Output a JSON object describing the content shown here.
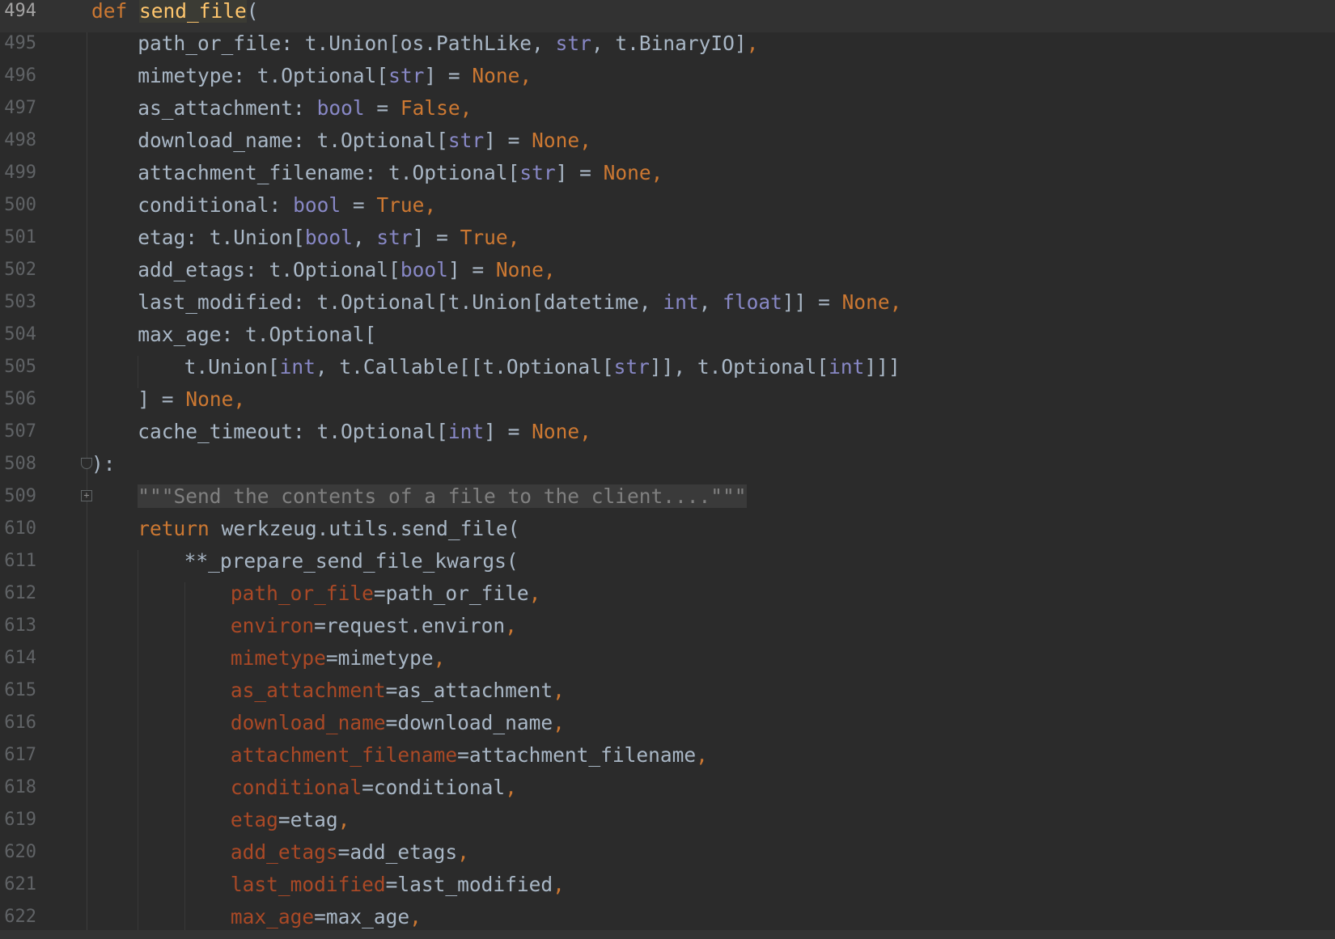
{
  "editor": {
    "current_line": "494",
    "lines": [
      {
        "num": "494",
        "indent": 0,
        "tokens": [
          [
            "def ",
            "keyword"
          ],
          [
            "|",
            "caret"
          ],
          [
            "send_file",
            "fn"
          ],
          [
            "(",
            "plain"
          ]
        ]
      },
      {
        "num": "495",
        "indent": 1,
        "tokens": [
          [
            "path_or_file: t.Union[os.PathLike, ",
            "plain"
          ],
          [
            "str",
            "builtin"
          ],
          [
            ", t.BinaryIO]",
            "plain"
          ],
          [
            ",",
            "punct"
          ]
        ]
      },
      {
        "num": "496",
        "indent": 1,
        "tokens": [
          [
            "mimetype: t.Optional[",
            "plain"
          ],
          [
            "str",
            "builtin"
          ],
          [
            "] = ",
            "plain"
          ],
          [
            "None",
            "const"
          ],
          [
            ",",
            "punct"
          ]
        ]
      },
      {
        "num": "497",
        "indent": 1,
        "tokens": [
          [
            "as_attachment: ",
            "plain"
          ],
          [
            "bool",
            "builtin"
          ],
          [
            " = ",
            "plain"
          ],
          [
            "False",
            "const"
          ],
          [
            ",",
            "punct"
          ]
        ]
      },
      {
        "num": "498",
        "indent": 1,
        "tokens": [
          [
            "download_name: t.Optional[",
            "plain"
          ],
          [
            "str",
            "builtin"
          ],
          [
            "] = ",
            "plain"
          ],
          [
            "None",
            "const"
          ],
          [
            ",",
            "punct"
          ]
        ]
      },
      {
        "num": "499",
        "indent": 1,
        "tokens": [
          [
            "attachment_filename: t.Optional[",
            "plain"
          ],
          [
            "str",
            "builtin"
          ],
          [
            "] = ",
            "plain"
          ],
          [
            "None",
            "const"
          ],
          [
            ",",
            "punct"
          ]
        ]
      },
      {
        "num": "500",
        "indent": 1,
        "tokens": [
          [
            "conditional: ",
            "plain"
          ],
          [
            "bool",
            "builtin"
          ],
          [
            " = ",
            "plain"
          ],
          [
            "True",
            "const"
          ],
          [
            ",",
            "punct"
          ]
        ]
      },
      {
        "num": "501",
        "indent": 1,
        "tokens": [
          [
            "etag: t.Union[",
            "plain"
          ],
          [
            "bool",
            "builtin"
          ],
          [
            ", ",
            "plain"
          ],
          [
            "str",
            "builtin"
          ],
          [
            "] = ",
            "plain"
          ],
          [
            "True",
            "const"
          ],
          [
            ",",
            "punct"
          ]
        ]
      },
      {
        "num": "502",
        "indent": 1,
        "tokens": [
          [
            "add_etags: t.Optional[",
            "plain"
          ],
          [
            "bool",
            "builtin"
          ],
          [
            "] = ",
            "plain"
          ],
          [
            "None",
            "const"
          ],
          [
            ",",
            "punct"
          ]
        ]
      },
      {
        "num": "503",
        "indent": 1,
        "tokens": [
          [
            "last_modified: t.Optional[t.Union[datetime, ",
            "plain"
          ],
          [
            "int",
            "builtin"
          ],
          [
            ", ",
            "plain"
          ],
          [
            "float",
            "builtin"
          ],
          [
            "]] = ",
            "plain"
          ],
          [
            "None",
            "const"
          ],
          [
            ",",
            "punct"
          ]
        ]
      },
      {
        "num": "504",
        "indent": 1,
        "tokens": [
          [
            "max_age: t.Optional[",
            "plain"
          ]
        ]
      },
      {
        "num": "505",
        "indent": 2,
        "tokens": [
          [
            "t.Union[",
            "plain"
          ],
          [
            "int",
            "builtin"
          ],
          [
            ", t.Callable[[t.Optional[",
            "plain"
          ],
          [
            "str",
            "builtin"
          ],
          [
            "]], t.Optional[",
            "plain"
          ],
          [
            "int",
            "builtin"
          ],
          [
            "]]]",
            "plain"
          ]
        ]
      },
      {
        "num": "506",
        "indent": 1,
        "tokens": [
          [
            "] = ",
            "plain"
          ],
          [
            "None",
            "const"
          ],
          [
            ",",
            "punct"
          ]
        ]
      },
      {
        "num": "507",
        "indent": 1,
        "tokens": [
          [
            "cache_timeout: t.Optional[",
            "plain"
          ],
          [
            "int",
            "builtin"
          ],
          [
            "] = ",
            "plain"
          ],
          [
            "None",
            "const"
          ],
          [
            ",",
            "punct"
          ]
        ]
      },
      {
        "num": "508",
        "indent": 0,
        "fold": "end",
        "tokens": [
          [
            "):",
            "plain"
          ]
        ]
      },
      {
        "num": "509",
        "indent": 1,
        "fold": "collapsed",
        "tokens": [
          [
            "\"\"\"Send the contents of a file to the client....\"\"\"",
            "doc"
          ]
        ]
      },
      {
        "num": "610",
        "indent": 1,
        "tokens": [
          [
            "return ",
            "keyword"
          ],
          [
            "werkzeug.utils.send_file(",
            "plain"
          ]
        ]
      },
      {
        "num": "611",
        "indent": 2,
        "tokens": [
          [
            "**_prepare_send_file_kwargs(",
            "plain"
          ]
        ]
      },
      {
        "num": "612",
        "indent": 3,
        "tokens": [
          [
            "path_or_file",
            "kwarg"
          ],
          [
            "=path_or_file",
            "plain"
          ],
          [
            ",",
            "punct"
          ]
        ]
      },
      {
        "num": "613",
        "indent": 3,
        "tokens": [
          [
            "environ",
            "kwarg"
          ],
          [
            "=request.environ",
            "plain"
          ],
          [
            ",",
            "punct"
          ]
        ]
      },
      {
        "num": "614",
        "indent": 3,
        "tokens": [
          [
            "mimetype",
            "kwarg"
          ],
          [
            "=mimetype",
            "plain"
          ],
          [
            ",",
            "punct"
          ]
        ]
      },
      {
        "num": "615",
        "indent": 3,
        "tokens": [
          [
            "as_attachment",
            "kwarg"
          ],
          [
            "=as_attachment",
            "plain"
          ],
          [
            ",",
            "punct"
          ]
        ]
      },
      {
        "num": "616",
        "indent": 3,
        "tokens": [
          [
            "download_name",
            "kwarg"
          ],
          [
            "=download_name",
            "plain"
          ],
          [
            ",",
            "punct"
          ]
        ]
      },
      {
        "num": "617",
        "indent": 3,
        "tokens": [
          [
            "attachment_filename",
            "kwarg"
          ],
          [
            "=attachment_filename",
            "plain"
          ],
          [
            ",",
            "punct"
          ]
        ]
      },
      {
        "num": "618",
        "indent": 3,
        "tokens": [
          [
            "conditional",
            "kwarg"
          ],
          [
            "=conditional",
            "plain"
          ],
          [
            ",",
            "punct"
          ]
        ]
      },
      {
        "num": "619",
        "indent": 3,
        "tokens": [
          [
            "etag",
            "kwarg"
          ],
          [
            "=etag",
            "plain"
          ],
          [
            ",",
            "punct"
          ]
        ]
      },
      {
        "num": "620",
        "indent": 3,
        "tokens": [
          [
            "add_etags",
            "kwarg"
          ],
          [
            "=add_etags",
            "plain"
          ],
          [
            ",",
            "punct"
          ]
        ]
      },
      {
        "num": "621",
        "indent": 3,
        "tokens": [
          [
            "last_modified",
            "kwarg"
          ],
          [
            "=last_modified",
            "plain"
          ],
          [
            ",",
            "punct"
          ]
        ]
      },
      {
        "num": "622",
        "indent": 3,
        "tokens": [
          [
            "max_age",
            "kwarg"
          ],
          [
            "=max_age",
            "plain"
          ],
          [
            ",",
            "punct"
          ]
        ]
      }
    ]
  },
  "colors": {
    "background": "#2b2b2b",
    "keyword": "#cc7832",
    "function": "#ffc66d",
    "builtin": "#8888c6",
    "kwarg": "#aa4926",
    "docstring": "#808080",
    "plain": "#a9b7c6"
  }
}
